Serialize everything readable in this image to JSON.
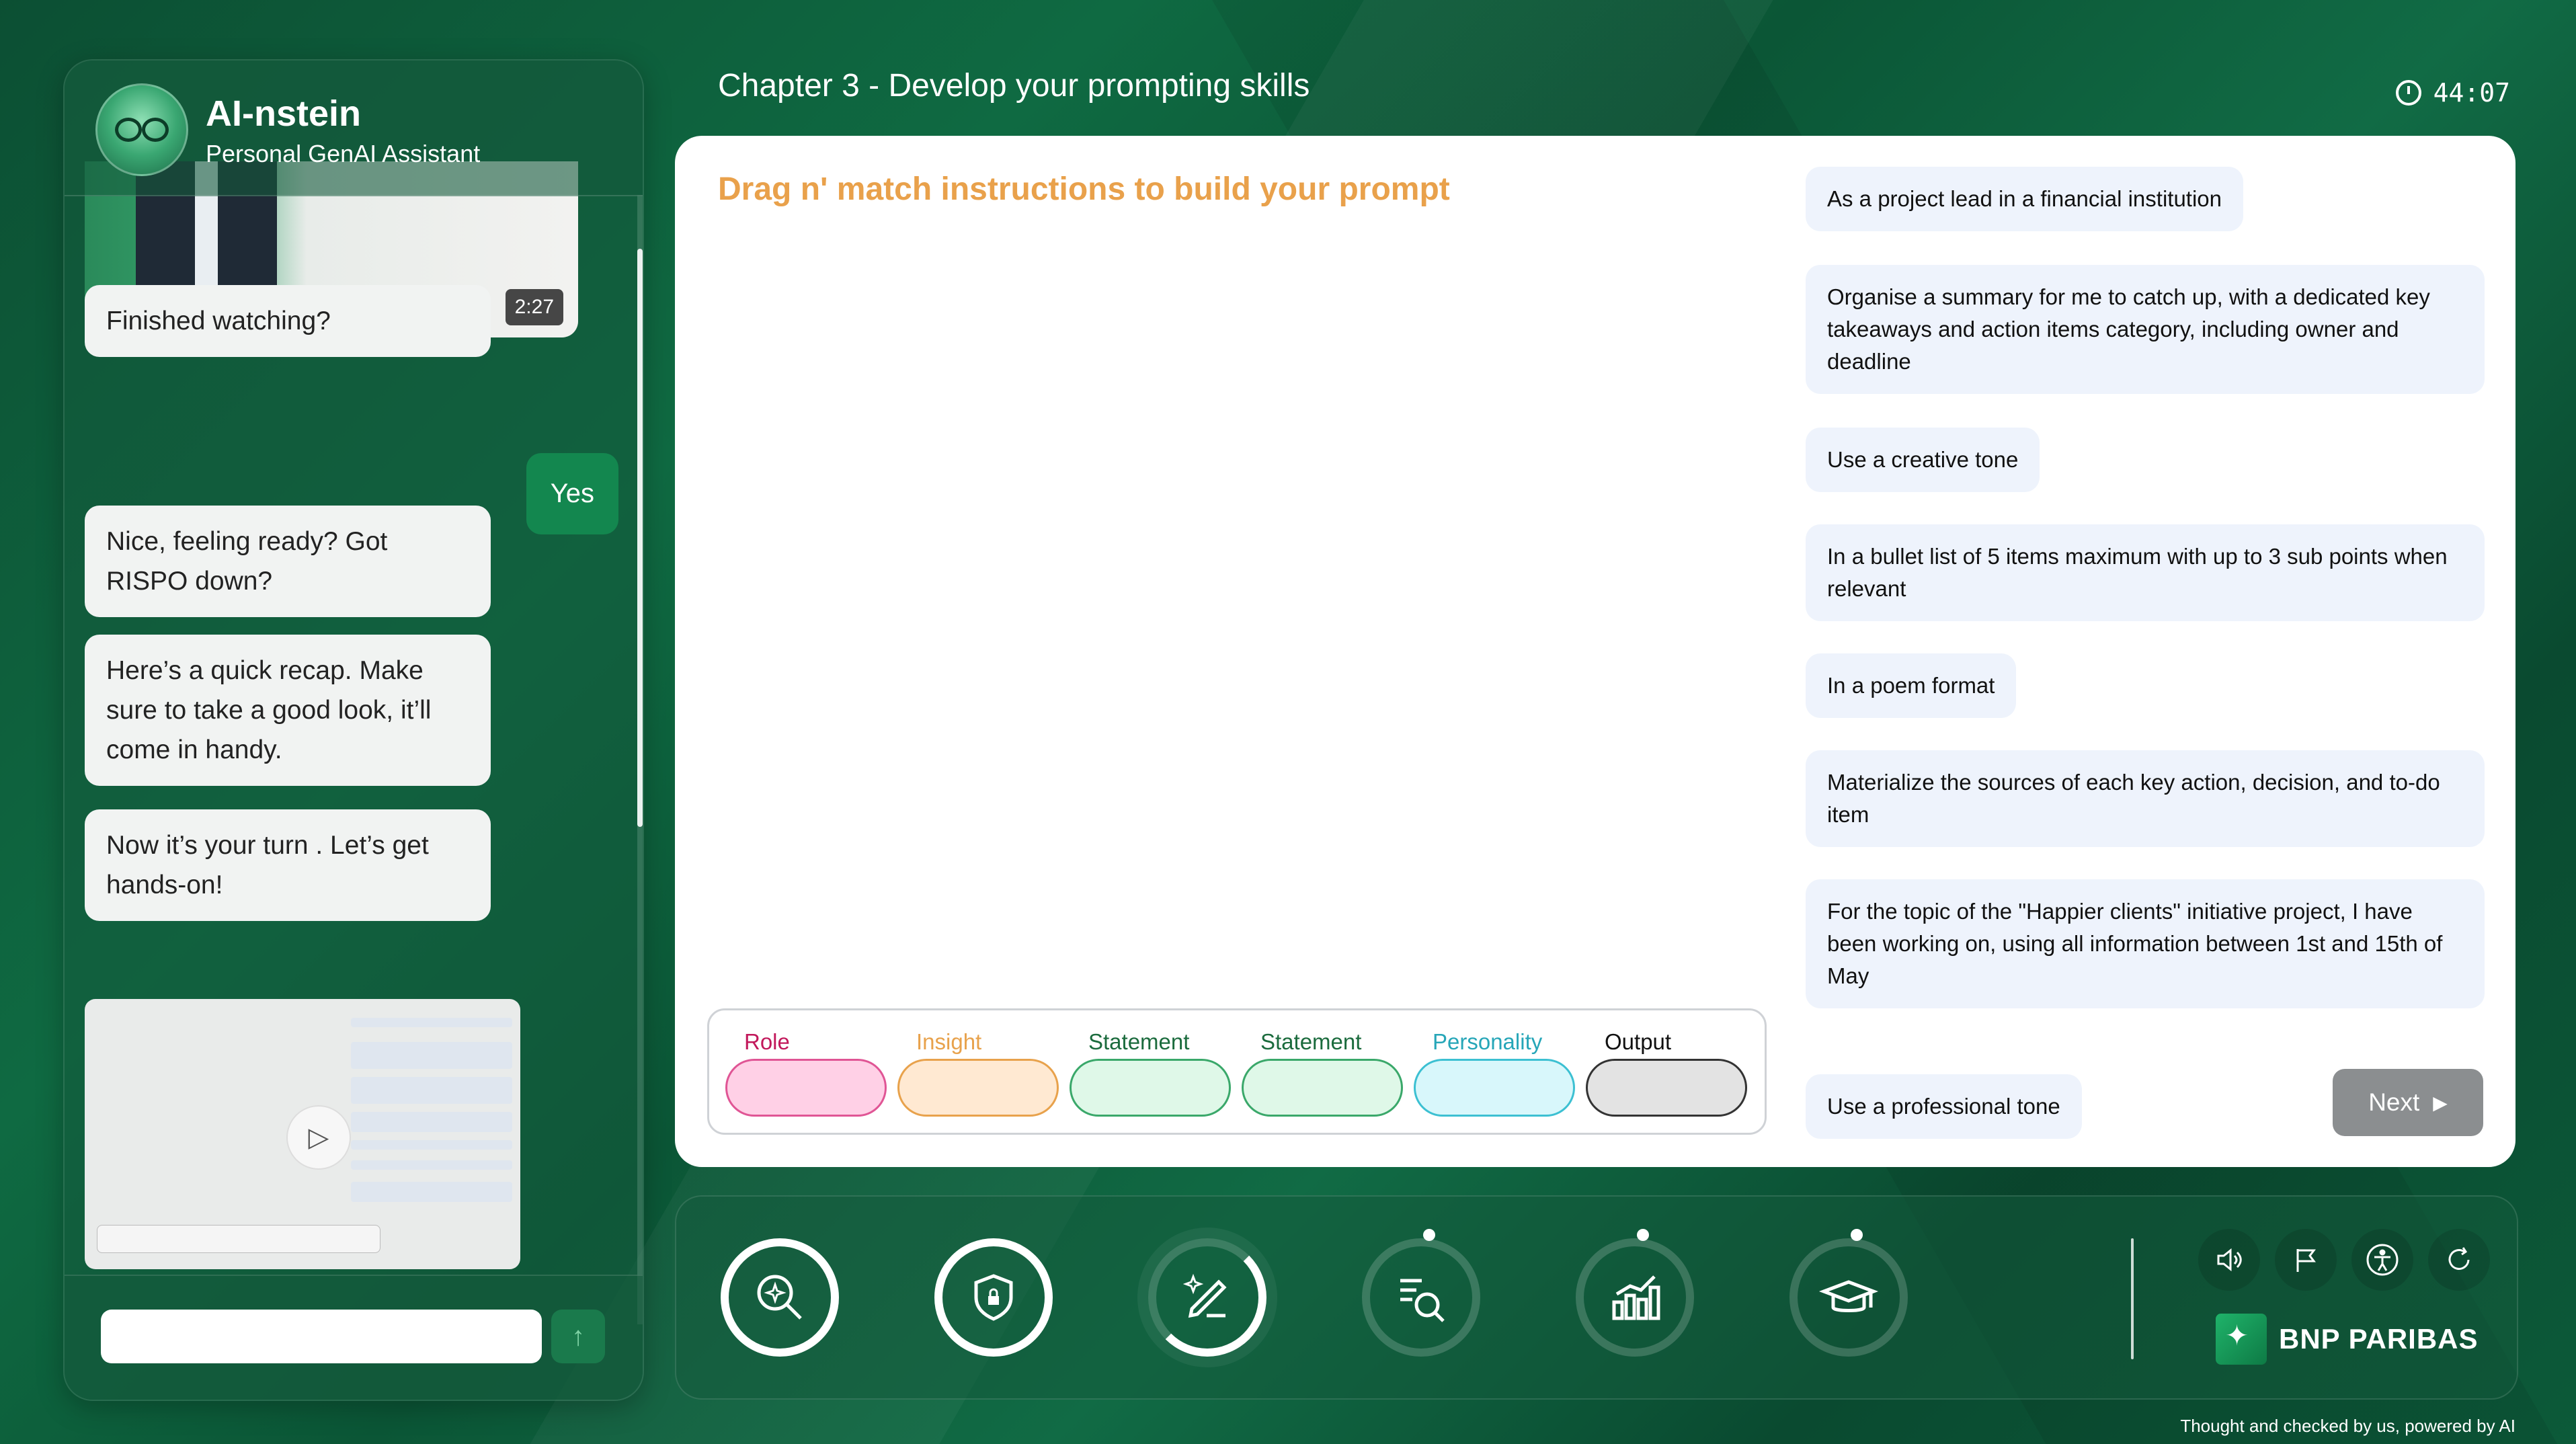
{
  "header": {
    "chapter_title": "Chapter 3 - Develop your prompting skills",
    "timer": "44:07"
  },
  "assistant": {
    "name": "AI-nstein",
    "subtitle": "Personal GenAI Assistant"
  },
  "chat": {
    "video_top_duration": "2:27",
    "messages": [
      {
        "from": "bot",
        "text": "Finished watching?"
      },
      {
        "from": "user",
        "text": "Yes"
      },
      {
        "from": "bot",
        "text": "Nice, feeling ready? Got RISPO down?"
      },
      {
        "from": "bot",
        "text": "Here’s a quick recap. Make sure to take a good look, it’ll come in handy."
      },
      {
        "from": "bot",
        "text": "Now it’s your turn . Let’s get hands-on!"
      }
    ],
    "input_placeholder": "",
    "send_icon": "arrow-up-icon"
  },
  "task": {
    "title": "Drag n' match instructions to build your prompt",
    "options": [
      "As a project lead in a financial institution",
      "Organise a summary for me to catch up, with a dedicated key takeaways and action items category, including owner and deadline",
      "Use a creative tone",
      "In a bullet list of 5 items maximum with up to 3 sub points when relevant",
      "In a poem format",
      "Materialize the sources of each key action, decision, and to-do item",
      "For the topic of the \"Happier clients\" initiative project, I have been working on, using all information between 1st and 15th of May",
      "Use a professional tone"
    ],
    "slots": [
      {
        "label": "Role",
        "label_color": "#c2185b",
        "fill": "#ffd0e6",
        "border": "#e05595"
      },
      {
        "label": "Insight",
        "label_color": "#e8a24c",
        "fill": "#ffe9d2",
        "border": "#e8a24c"
      },
      {
        "label": "Statement",
        "label_color": "#1b6b3d",
        "fill": "#dff8e8",
        "border": "#3aa86a"
      },
      {
        "label": "Statement",
        "label_color": "#1b6b3d",
        "fill": "#dff8e8",
        "border": "#3aa86a"
      },
      {
        "label": "Personality",
        "label_color": "#26a6b8",
        "fill": "#d8f7fb",
        "border": "#3cc0d2"
      },
      {
        "label": "Output",
        "label_color": "#111111",
        "fill": "#e3e3e3",
        "border": "#333333"
      }
    ],
    "next_label": "Next"
  },
  "toolbar": {
    "tools": [
      {
        "name": "search-sparkle-icon",
        "state": "completed"
      },
      {
        "name": "shield-lock-icon",
        "state": "completed"
      },
      {
        "name": "pen-sparkle-icon",
        "state": "in-progress"
      },
      {
        "name": "list-search-icon",
        "state": "locked"
      },
      {
        "name": "chart-bars-icon",
        "state": "locked"
      },
      {
        "name": "graduation-cap-icon",
        "state": "locked"
      }
    ],
    "utilities": [
      "sound-icon",
      "flag-icon",
      "accessibility-icon",
      "refresh-icon"
    ],
    "brand": "BNP PARIBAS"
  },
  "footer_note": "Thought and checked by us, powered by AI",
  "colors": {
    "accent_orange": "#e9a14b",
    "user_bubble": "#13874f",
    "option_bg": "#eef3fc",
    "next_button": "#8b8e90"
  }
}
